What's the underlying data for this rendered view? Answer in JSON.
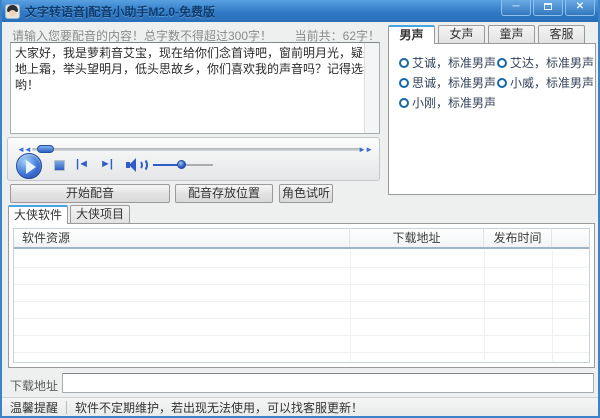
{
  "window": {
    "title": "文字转语音|配音小助手M2.0-免费版",
    "controls": {
      "minimize_icon": "─",
      "close_icon": "✕"
    }
  },
  "compose": {
    "prompt_label": "请输入您要配音的内容！总字数不得超过300字！",
    "count_label": "当前共：62字！",
    "text": "大家好，我是萝莉音艾宝，现在给你们念首诗吧，窗前明月光，疑是地上霜，举头望明月，低头思故乡，你们喜欢我的声音吗？记得选我哟！"
  },
  "player": {
    "rewind_icon": "◄◄",
    "forward_icon": "►►",
    "prev_icon": "|◄",
    "next_icon": "►|"
  },
  "actions": {
    "start": "开始配音",
    "save_location": "配音存放位置",
    "audition": "角色试听"
  },
  "voice_panel": {
    "tabs": [
      {
        "label": "男声",
        "active": true
      },
      {
        "label": "女声",
        "active": false
      },
      {
        "label": "童声",
        "active": false
      },
      {
        "label": "客服",
        "active": false
      }
    ],
    "options": [
      "艾诚，标准男声",
      "艾达，标准男声",
      "思诚，标准男声",
      "小威，标准男声",
      "小刚，标准男声"
    ]
  },
  "resource_panel": {
    "tabs": [
      {
        "label": "大侠软件",
        "active": true
      },
      {
        "label": "大侠项目",
        "active": false
      }
    ],
    "columns": [
      "软件资源",
      "下载地址",
      "发布时间"
    ],
    "rows": []
  },
  "download": {
    "label": "下载地址",
    "value": ""
  },
  "statusbar": {
    "badge": "温馨提醒",
    "message": "软件不定期维护，若出现无法使用，可以找客服更新！"
  },
  "colors": {
    "titlebar_blue": "#2e77c4",
    "accent_blue": "#2f5ec6",
    "tab_highlight": "#44a4e4",
    "window_border": "#3b82c9"
  }
}
